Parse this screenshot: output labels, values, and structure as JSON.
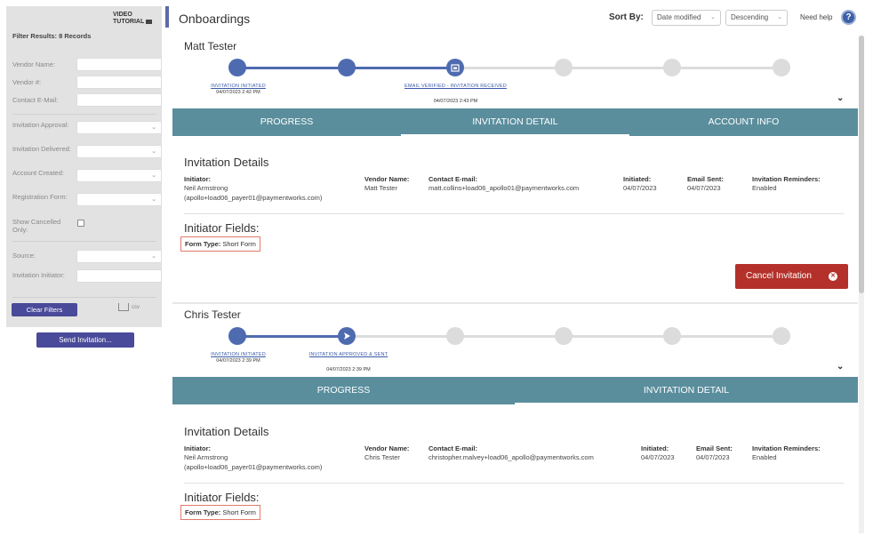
{
  "sidebar": {
    "video_tutorial": "VIDEO TUTORIAL",
    "filter_results": "Filter Results: 8 Records",
    "fields": {
      "vendor_name": "Vendor Name:",
      "vendor_num": "Vendor #:",
      "contact_email": "Contact E-Mail:",
      "invitation_approval": "Invitation Approval:",
      "invitation_delivered": "Invitation Delivered:",
      "account_created": "Account Created:",
      "registration_form": "Registration Form:",
      "show_cancelled": "Show Cancelled Only:",
      "source": "Source:",
      "invitation_initiator": "Invitation Initiator:"
    },
    "clear_filters": "Clear Filters",
    "csv": "csv",
    "send_invitation": "Send Invitation..."
  },
  "header": {
    "title": "Onboardings",
    "sort_by": "Sort By:",
    "sort_field": "Date modified",
    "sort_order": "Descending",
    "need_help": "Need help",
    "help_symbol": "?"
  },
  "cards": [
    {
      "name": "Matt Tester",
      "progress_fraction": 0.4,
      "steps": [
        {
          "label": "INVITATION INITIATED",
          "date": "04/07/2023 2:42 PM"
        },
        {
          "label": "EMAIL VERIFIED - INVITATION RECEIVED",
          "date": "04/07/2023 2:43 PM"
        }
      ],
      "tabs": [
        "PROGRESS",
        "INVITATION DETAIL",
        "ACCOUNT INFO"
      ],
      "active_tab": "INVITATION DETAIL",
      "details": {
        "section_title": "Invitation Details",
        "initiator_label": "Initiator:",
        "initiator_name": "Neil Armstrong",
        "initiator_email": "(apollo+load06_payer01@paymentworks.com)",
        "vendor_name_label": "Vendor Name:",
        "vendor_name": "Matt Tester",
        "contact_email_label": "Contact E-mail:",
        "contact_email": "matt.collins+load06_apollo01@paymentworks.com",
        "initiated_label": "Initiated:",
        "initiated": "04/07/2023",
        "email_sent_label": "Email Sent:",
        "email_sent": "04/07/2023",
        "reminders_label": "Invitation Reminders:",
        "reminders": "Enabled"
      },
      "initiator_fields_title": "Initiator Fields:",
      "form_type_label": "Form Type:",
      "form_type": "Short Form",
      "cancel_button": "Cancel Invitation"
    },
    {
      "name": "Chris Tester",
      "progress_fraction": 0.2,
      "steps": [
        {
          "label": "INVITATION INITIATED",
          "date": "04/07/2023 2:39 PM"
        },
        {
          "label": "INVITATION APPROVED & SENT",
          "date": "04/07/2023 2:39 PM"
        }
      ],
      "tabs": [
        "PROGRESS",
        "INVITATION DETAIL"
      ],
      "active_tab": "INVITATION DETAIL",
      "details": {
        "section_title": "Invitation Details",
        "initiator_label": "Initiator:",
        "initiator_name": "Neil Armstrong",
        "initiator_email": "(apollo+load06_payer01@paymentworks.com)",
        "vendor_name_label": "Vendor Name:",
        "vendor_name": "Chris Tester",
        "contact_email_label": "Contact E-mail:",
        "contact_email": "christopher.malvey+load06_apollo@paymentworks.com",
        "initiated_label": "Initiated:",
        "initiated": "04/07/2023",
        "email_sent_label": "Email Sent:",
        "email_sent": "04/07/2023",
        "reminders_label": "Invitation Reminders:",
        "reminders": "Enabled"
      },
      "initiator_fields_title": "Initiator Fields:",
      "form_type_label": "Form Type:",
      "form_type": "Short Form"
    }
  ],
  "colors": {
    "accent": "#4a4a9a",
    "tab_bar": "#5a8e9d",
    "progress": "#4f6bb0",
    "cancel": "#b3312a"
  }
}
